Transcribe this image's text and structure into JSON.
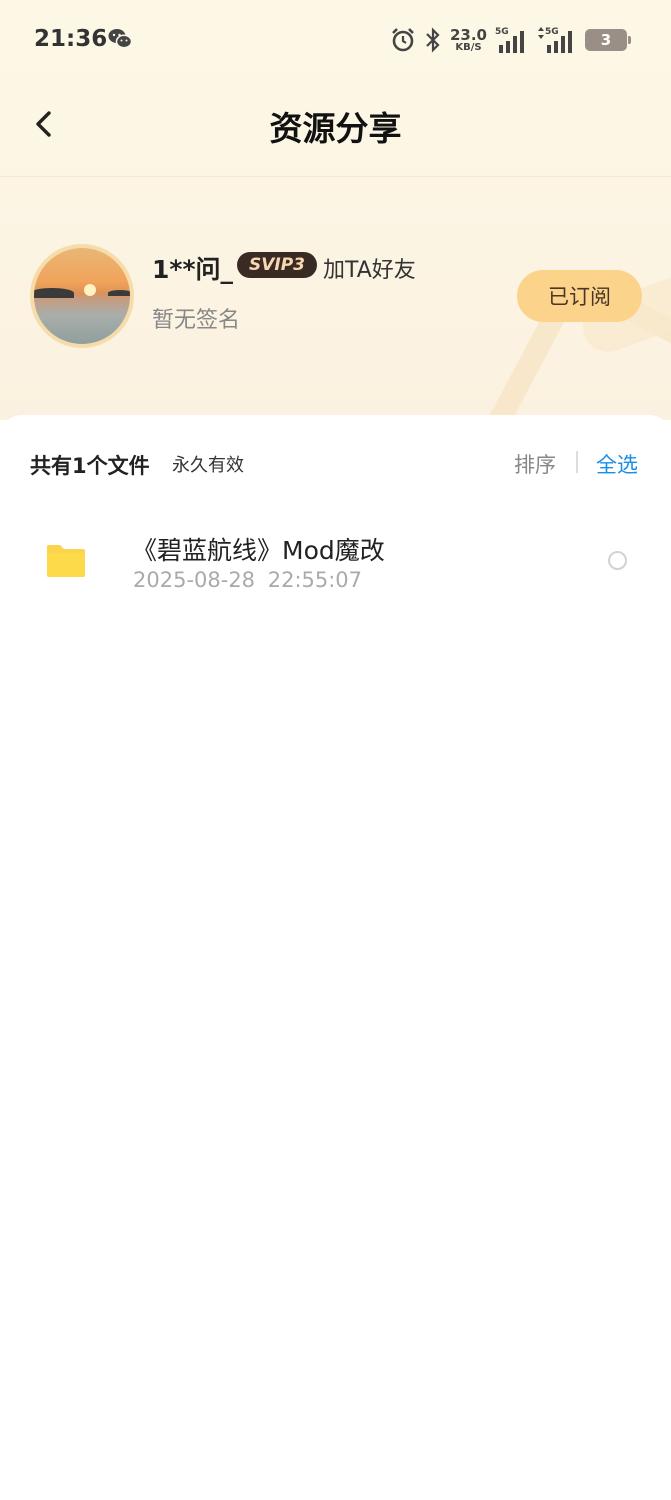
{
  "status_bar": {
    "time": "21:36",
    "net_speed_value": "23.0",
    "net_speed_unit": "KB/S",
    "signal1_label": "5G",
    "signal2_label": "5G",
    "battery": "3",
    "icons": [
      "wechat-icon",
      "alarm-icon",
      "bluetooth-icon",
      "signal-icon",
      "battery-icon"
    ]
  },
  "nav": {
    "title": "资源分享",
    "back_icon": "chevron-left-icon"
  },
  "profile": {
    "username": "1**问_",
    "vip_badge": "SVIP3",
    "add_friend": "加TA好友",
    "signature": "暂无签名",
    "subscribe_label": "已订阅"
  },
  "list": {
    "file_count": "共有1个文件",
    "validity": "永久有效",
    "sort_label": "排序",
    "select_all_label": "全选",
    "items": [
      {
        "name": "《碧蓝航线》Mod魔改",
        "date": "2025-08-28 22:55:07",
        "icon": "folder-icon"
      }
    ]
  },
  "colors": {
    "accent": "#1a8ee6",
    "subscribe_bg": "#fbd38a",
    "folder": "#fcd34d",
    "badge_bg": "#3a2a24"
  }
}
